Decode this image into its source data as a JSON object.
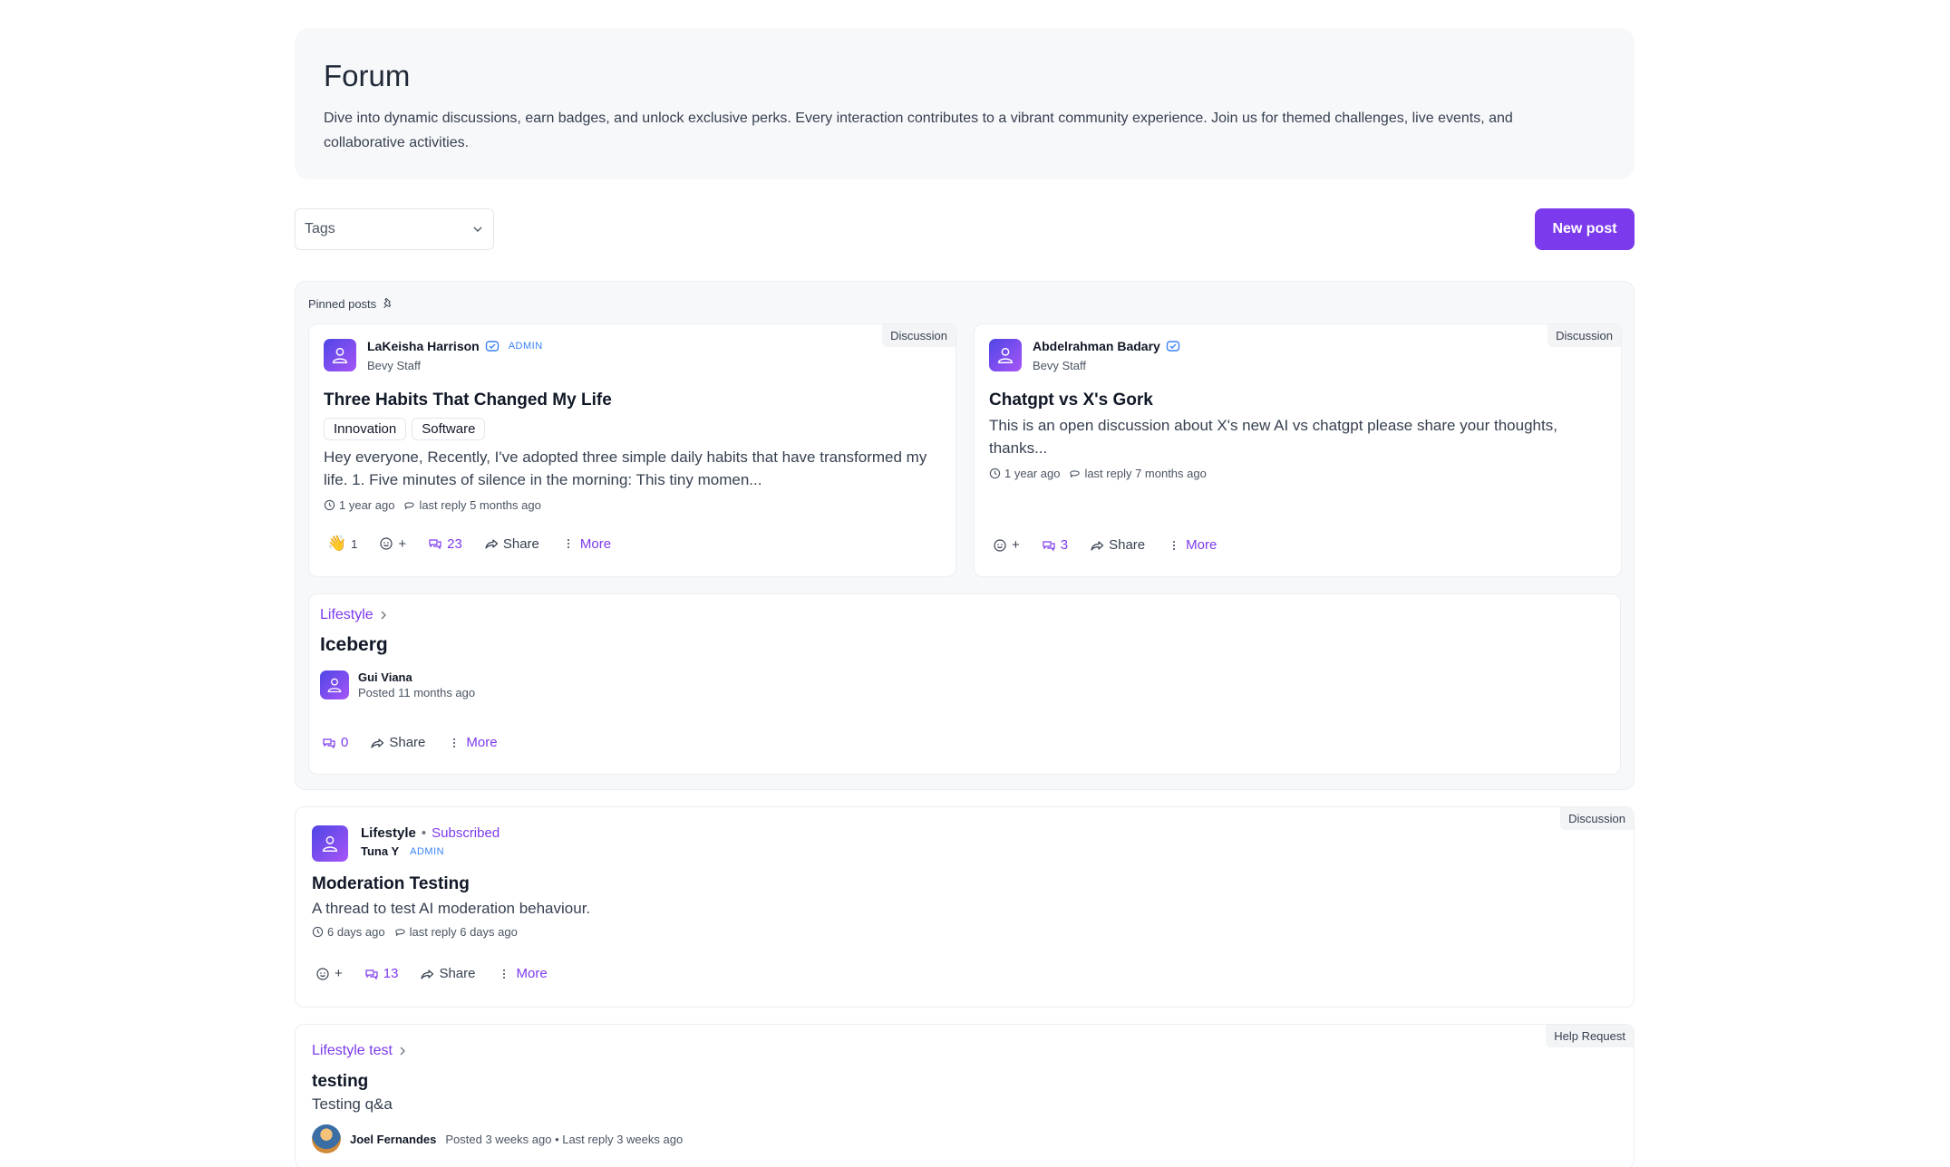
{
  "header": {
    "title": "Forum",
    "description": "Dive into dynamic discussions, earn badges, and unlock exclusive perks. Every interaction contributes to a vibrant community experience. Join us for themed challenges, live events, and collaborative activities."
  },
  "toolbar": {
    "tags_placeholder": "Tags",
    "new_post_label": "New post"
  },
  "pinned": {
    "label": "Pinned posts",
    "posts": [
      {
        "type": "Discussion",
        "author": "LaKeisha Harrison",
        "role_badge": "ADMIN",
        "org": "Bevy Staff",
        "title": "Three Habits That Changed My Life",
        "tags": [
          "Innovation",
          "Software"
        ],
        "excerpt": "Hey everyone, Recently, I've adopted three simple daily habits that have transformed my life. 1. Five minutes of silence in the morning: This tiny momen...",
        "posted": "1 year ago",
        "last_reply": "last reply 5 months ago",
        "reaction_emoji": "👋",
        "reaction_count": "1",
        "react_add": "+",
        "comments": "23",
        "share": "Share",
        "more": "More"
      },
      {
        "type": "Discussion",
        "author": "Abdelrahman Badary",
        "org": "Bevy Staff",
        "title": "Chatgpt vs X's Gork",
        "excerpt": "This is an open discussion about X's new AI vs chatgpt please share your thoughts, thanks...",
        "posted": "1 year ago",
        "last_reply": "last reply 7 months ago",
        "react_add": "+",
        "comments": "3",
        "share": "Share",
        "more": "More"
      }
    ],
    "thread": {
      "category": "Lifestyle",
      "title": "Iceberg",
      "author": "Gui Viana",
      "posted": "Posted 11 months ago",
      "comments": "0",
      "share": "Share",
      "more": "More"
    }
  },
  "feed": [
    {
      "type": "Discussion",
      "category": "Lifestyle",
      "separator": "•",
      "subscribed": "Subscribed",
      "author": "Tuna Y",
      "role_badge": "ADMIN",
      "title": "Moderation Testing",
      "description": "A thread to test AI moderation behaviour.",
      "posted": "6 days ago",
      "last_reply": "last reply 6 days ago",
      "react_add": "+",
      "comments": "13",
      "share": "Share",
      "more": "More"
    },
    {
      "type": "Help Request",
      "category": "Lifestyle test",
      "title": "testing",
      "description": "Testing q&a",
      "author": "Joel Fernandes",
      "posted": "Posted 3 weeks ago • Last reply 3 weeks ago"
    }
  ],
  "colors": {
    "accent": "#7c3aed",
    "admin": "#3b82f6",
    "panel": "#f7f8fa"
  }
}
